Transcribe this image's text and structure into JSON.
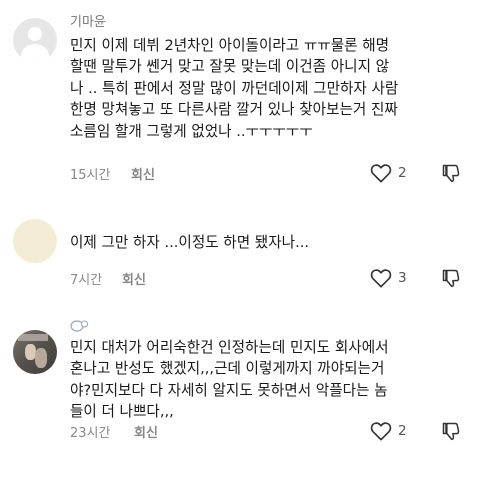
{
  "comments": [
    {
      "username": "기마윤",
      "text": "민지 이제 데뷔 2년차인 아이돌이라고 ㅠㅠ물론 해명\n할땐 말투가 쎈거 맞고 잘못 맞는데 이건좀 아니지 않\n나 .. 특히 판에서 정말 많이 까던데이제 그만하자 사람\n한명 망쳐놓고 또 다른사람 깔거 있나 찾아보는거 진짜\n소름임 할개 그렇게 없었나 ..ㅜㅜㅜㅜㅜ",
      "time": "15시간",
      "reply_label": "회신",
      "likes": "2"
    },
    {
      "username": "",
      "text": "이제 그만 하자 ...이정도 하면 됐자나...",
      "time": "7시간",
      "reply_label": "회신",
      "likes": "3"
    },
    {
      "username": "",
      "text": "민지 대처가 어리숙한건 인정하는데 민지도 회사에서\n혼나고 반성도 했겠지,,,근데 이렇게까지 까야되는거\n야?민지보다 다 자세히 알지도 못하면서 악플다는 놈\n들이 더 나쁘다,,,",
      "time": "23시간",
      "reply_label": "회신",
      "likes": "2"
    }
  ],
  "icons": {
    "like": "heart-outline-icon",
    "dislike": "thumbs-down-icon",
    "username_decoration": "speech-bubble-icon"
  },
  "colors": {
    "text": "#1a1a1a",
    "meta": "#888888",
    "icon": "#333333"
  }
}
